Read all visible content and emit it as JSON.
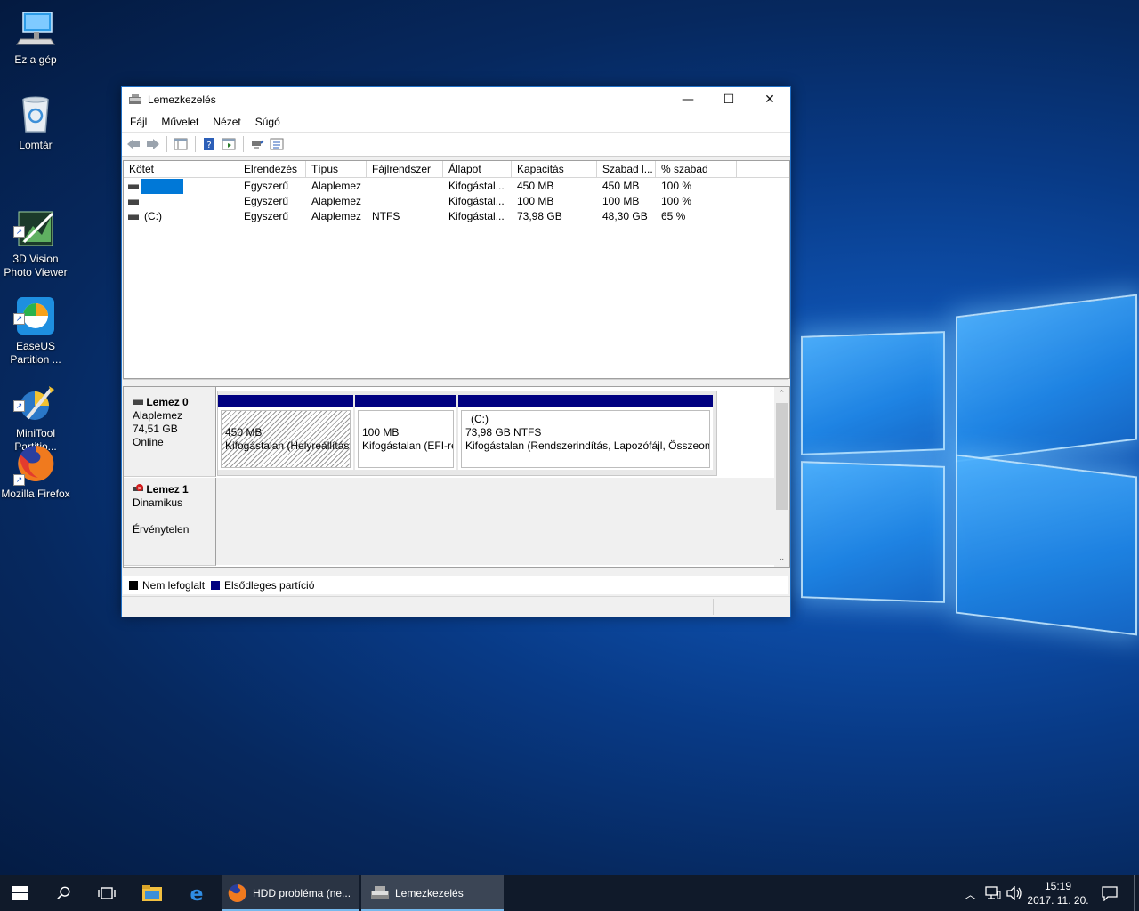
{
  "desktop": {
    "icons": [
      {
        "label": "Ez a gép",
        "icon": "computer-icon"
      },
      {
        "label": "Lomtár",
        "icon": "recycle-bin-icon"
      },
      {
        "label": "3D Vision\nPhoto Viewer",
        "icon": "3d-vision-icon"
      },
      {
        "label": "EaseUS\nPartition ...",
        "icon": "easeus-icon"
      },
      {
        "label": "MiniTool\nPartitio...",
        "icon": "minitool-icon"
      },
      {
        "label": "Mozilla Firefox",
        "icon": "firefox-icon"
      }
    ]
  },
  "window": {
    "title": "Lemezkezelés",
    "controls": {
      "minimize": "—",
      "maximize": "☐",
      "close": "✕"
    },
    "menu": [
      "Fájl",
      "Művelet",
      "Nézet",
      "Súgó"
    ],
    "toolbar": [
      "back-icon",
      "forward-icon",
      "properties-icon",
      "help-icon",
      "settings-icon",
      "connect-icon",
      "checklist-icon"
    ],
    "columns": [
      "Kötet",
      "Elrendezés",
      "Típus",
      "Fájlrendszer",
      "Állapot",
      "Kapacitás",
      "Szabad l...",
      "% szabad"
    ],
    "volumes": [
      {
        "name": "",
        "layout": "Egyszerű",
        "type": "Alaplemez",
        "fs": "",
        "status": "Kifogástal...",
        "capacity": "450 MB",
        "free": "450 MB",
        "pct": "100 %",
        "selected": true
      },
      {
        "name": "",
        "layout": "Egyszerű",
        "type": "Alaplemez",
        "fs": "",
        "status": "Kifogástal...",
        "capacity": "100 MB",
        "free": "100 MB",
        "pct": "100 %",
        "selected": false
      },
      {
        "name": "(C:)",
        "layout": "Egyszerű",
        "type": "Alaplemez",
        "fs": "NTFS",
        "status": "Kifogástal...",
        "capacity": "73,98 GB",
        "free": "48,30 GB",
        "pct": "65 %",
        "selected": false
      }
    ],
    "disks": [
      {
        "name": "Lemez 0",
        "kind": "Alaplemez",
        "size": "74,51 GB",
        "state": "Online",
        "partitions": [
          {
            "title": "",
            "size": "450 MB",
            "desc": "Kifogástalan (Helyreállítási partíció)"
          },
          {
            "title": "",
            "size": "100 MB",
            "desc": "Kifogástalan (EFI-rendszerpartíció)"
          },
          {
            "title": "(C:)",
            "size": "73,98 GB NTFS",
            "desc": "Kifogástalan (Rendszerindítás, Lapozófájl, Összeomlási memóriakép)"
          }
        ]
      },
      {
        "name": "Lemez 1",
        "kind": "Dinamikus",
        "size": "",
        "state": "Érvénytelen"
      }
    ],
    "legend": [
      {
        "label": "Nem lefoglalt",
        "color": "#000000"
      },
      {
        "label": "Elsődleges partíció",
        "color": "#000080"
      }
    ]
  },
  "taskbar": {
    "tasks": [
      {
        "label": "HDD probléma (ne...",
        "icon": "firefox-icon"
      },
      {
        "label": "Lemezkezelés",
        "icon": "disk-management-icon"
      }
    ],
    "time": "15:19",
    "date": "2017. 11. 20."
  },
  "colors": {
    "primary_partition": "#000080",
    "accent": "#0078d7"
  }
}
